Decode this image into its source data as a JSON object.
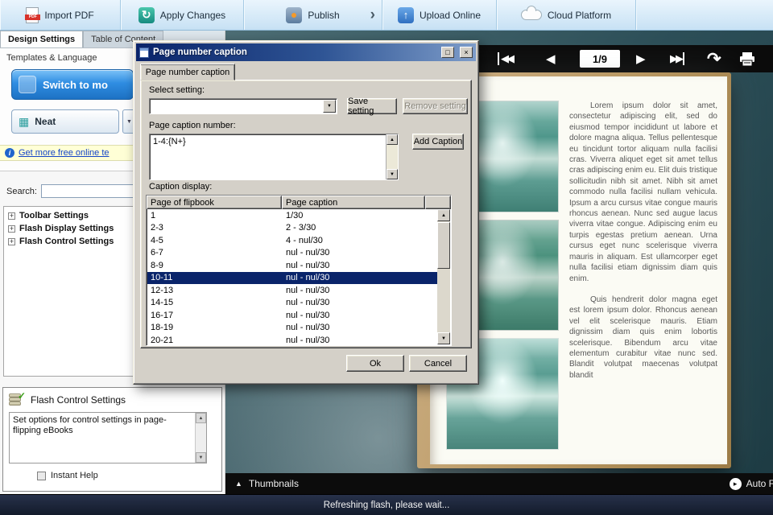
{
  "colors": {
    "accent_blue": "#2f8de2",
    "selection_blue": "#0a246a",
    "dialog_bg": "#d4d0c8",
    "toolbar_blue": "#c7e1f4",
    "viewer_teal": "#2c4e57",
    "book_tan": "#b79660"
  },
  "icons": {
    "chevron": "›",
    "up": "▲",
    "down": "▼",
    "left": "◀",
    "right": "▶",
    "left2": "◀◀",
    "right2": "▶▶",
    "flip_back": "↶",
    "flip_fwd": "↷",
    "plus": "+",
    "info": "i",
    "refresh": "↻",
    "upload": "↑",
    "check": "✓",
    "neat_glyph": "▦",
    "pdf": "PDF",
    "maximize": "□",
    "close": "×",
    "play": "▸"
  },
  "toolbar": {
    "items": [
      {
        "label": "Import PDF"
      },
      {
        "label": "Apply Changes"
      },
      {
        "label": "Publish"
      },
      {
        "label": "Upload Online"
      },
      {
        "label": "Cloud Platform"
      }
    ]
  },
  "left_panel": {
    "tabs": [
      {
        "label": "Design Settings"
      },
      {
        "label": "Table of Content"
      }
    ],
    "templates_title": "Templates & Language",
    "switch_button": "Switch to mo",
    "neat_button": "Neat",
    "more_link": "Get more free online te",
    "search_label": "Search:",
    "tree": [
      {
        "label": "Toolbar Settings"
      },
      {
        "label": "Flash Display Settings"
      },
      {
        "label": "Flash Control Settings"
      }
    ],
    "info_title": "Flash Control Settings",
    "info_text": "Set options for control settings in page-flipping eBooks",
    "instant_help": "Instant Help"
  },
  "dialog": {
    "title": "Page number caption",
    "tab": "Page number caption",
    "select_setting_label": "Select setting:",
    "select_setting_value": "",
    "save_button": "Save setting",
    "remove_button": "Remove setting",
    "caption_number_label": "Page caption number:",
    "caption_number_value": "1-4:{N+}",
    "add_caption_button": "Add Caption",
    "caption_display_label": "Caption display:",
    "table": {
      "headers": [
        "Page of flipbook",
        "Page caption"
      ],
      "rows": [
        [
          "1",
          "1/30"
        ],
        [
          "2-3",
          "2 - 3/30"
        ],
        [
          "4-5",
          "4 - nul/30"
        ],
        [
          "6-7",
          "nul - nul/30"
        ],
        [
          "8-9",
          "nul - nul/30"
        ],
        [
          "10-11",
          "nul - nul/30"
        ],
        [
          "12-13",
          "nul - nul/30"
        ],
        [
          "14-15",
          "nul - nul/30"
        ],
        [
          "16-17",
          "nul - nul/30"
        ],
        [
          "18-19",
          "nul - nul/30"
        ],
        [
          "20-21",
          "nul - nul/30"
        ]
      ],
      "selected_row": 5
    },
    "ok_button": "Ok",
    "cancel_button": "Cancel"
  },
  "viewer": {
    "page_indicator": "1/9",
    "thumbnails_label": "Thumbnails",
    "auto_flip_label": "Auto Flip",
    "book": {
      "p1": "Lorem ipsum dolor sit amet, consectetur adipiscing elit, sed do eiusmod tempor incididunt ut labore et dolore magna aliqua. Tellus pellentesque eu tincidunt tortor aliquam nulla facilisi cras. Viverra aliquet eget sit amet tellus cras adipiscing enim eu. Elit duis tristique sollicitudin nibh sit amet. Nibh sit amet commodo nulla facilisi nullam vehicula. Ipsum a arcu cursus vitae congue mauris rhoncus aenean. Nunc sed augue lacus viverra vitae congue. Adipiscing enim eu turpis egestas pretium aenean. Urna cursus eget nunc scelerisque viverra mauris in aliquam. Est ullamcorper eget nulla facilisi etiam dignissim diam quis enim.",
      "p2": "Quis hendrerit dolor magna eget est lorem ipsum dolor. Rhoncus aenean vel elit scelerisque mauris. Etiam dignissim diam quis enim lobortis scelerisque. Bibendum arcu vitae elementum curabitur vitae nunc sed. Blandit volutpat maecenas volutpat blandit"
    }
  },
  "status_bar": "Refreshing flash, please wait..."
}
